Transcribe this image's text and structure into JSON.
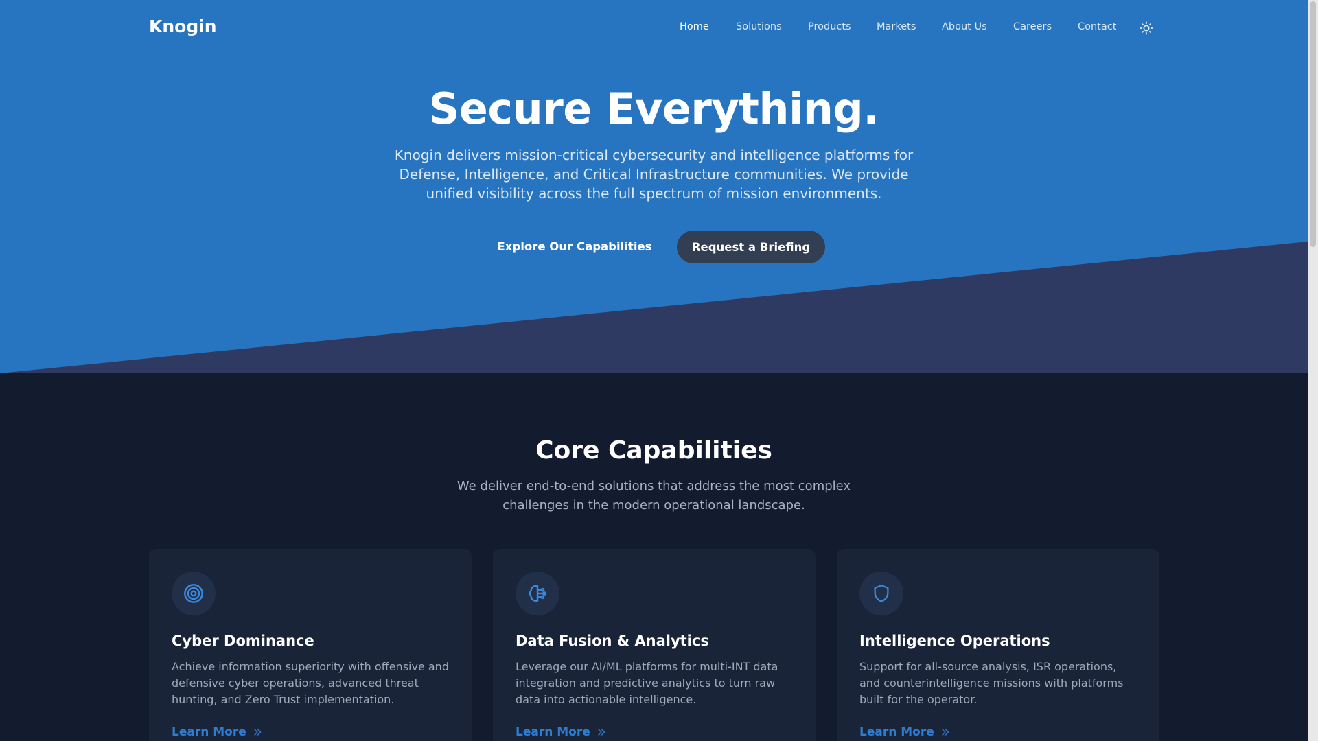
{
  "nav": {
    "logo": "Knogin",
    "links": [
      "Home",
      "Solutions",
      "Products",
      "Markets",
      "About Us",
      "Careers",
      "Contact"
    ],
    "active": "Home",
    "theme_icon": "sun-icon"
  },
  "hero": {
    "title": "Secure Everything.",
    "text": "Knogin delivers mission-critical cybersecurity and intelligence platforms for Defense, Intelligence, and Critical Infrastructure communities. We provide unified visibility across the full spectrum of mission environments.",
    "primary_button": "Explore Our Capabilities",
    "secondary_button": "Request a Briefing"
  },
  "capabilities": {
    "title": "Core Capabilities",
    "subtitle": "We deliver end-to-end solutions that address the most complex challenges in the modern operational landscape.",
    "cards": [
      {
        "icon": "target-icon",
        "title": "Cyber Dominance",
        "text": "Achieve information superiority with offensive and defensive cyber operations, advanced threat hunting, and Zero Trust implementation.",
        "link": "Learn More"
      },
      {
        "icon": "brain-icon",
        "title": "Data Fusion & Analytics",
        "text": "Leverage our AI/ML platforms for multi-INT data integration and predictive analytics to turn raw data into actionable intelligence.",
        "link": "Learn More"
      },
      {
        "icon": "shield-icon",
        "title": "Intelligence Operations",
        "text": "Support for all-source analysis, ISR operations, and counterintelligence missions with platforms built for the operator.",
        "link": "Learn More"
      }
    ]
  },
  "colors": {
    "hero_blue": "#2775c0",
    "hero_wedge": "#2e3a62",
    "page_bg": "#131b2e",
    "card_bg": "#1a2438",
    "accent": "#2e7dd0",
    "button_dark": "#323e52"
  }
}
